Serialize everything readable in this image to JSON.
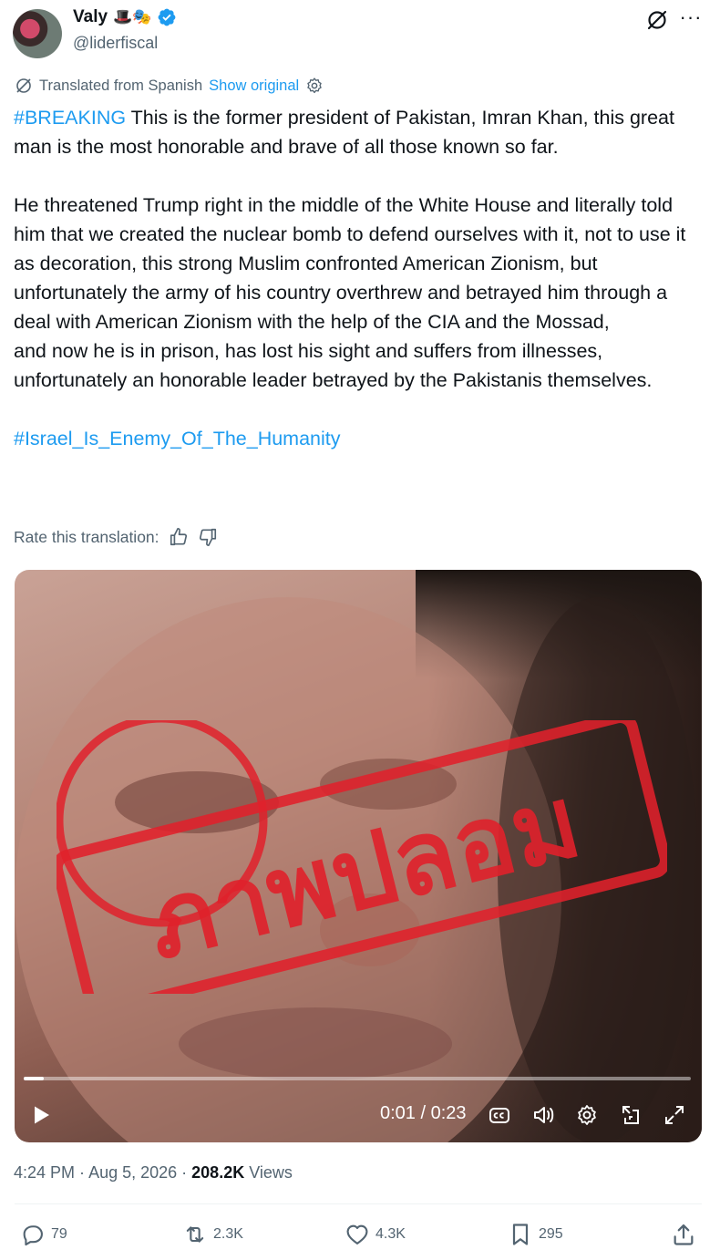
{
  "author": {
    "name": "Valy",
    "emojis": "🎩🎭",
    "handle": "@liderfiscal"
  },
  "translation": {
    "label": "Translated from Spanish",
    "show_original": "Show original"
  },
  "tweet": {
    "hashtag_breaking": "#BREAKING",
    "line1_rest": " This is the former president of Pakistan, Imran Khan, this great man is the most honorable and brave of all those known so far.",
    "paragraph2": "He threatened Trump right in the middle of the White House and literally told him that we created the nuclear bomb to defend ourselves with it, not to use it as decoration, this strong Muslim confronted American Zionism, but unfortunately the army of his country overthrew and betrayed him through a deal with American Zionism with the help of the CIA and the Mossad,",
    "paragraph3": "and now he is in prison, has lost his sight and suffers from illnesses, unfortunately an honorable leader betrayed by the Pakistanis themselves.",
    "hashtag_end": "#Israel_Is_Enemy_Of_The_Humanity"
  },
  "rate": {
    "label": "Rate this translation:"
  },
  "media": {
    "stamp_text": "ภาพปลอม",
    "time": "0:01 / 0:23",
    "progress": 0.03
  },
  "meta": {
    "time": "4:24 PM",
    "date": "Aug 5, 2026",
    "views_count": "208.2K",
    "views_label": "Views"
  },
  "actions": {
    "replies": "79",
    "reposts": "2.3K",
    "likes": "4.3K",
    "bookmarks": "295"
  },
  "colors": {
    "accent": "#1d9bf0",
    "text": "#0f1419",
    "secondary": "#536471",
    "stamp": "#e0212b"
  }
}
